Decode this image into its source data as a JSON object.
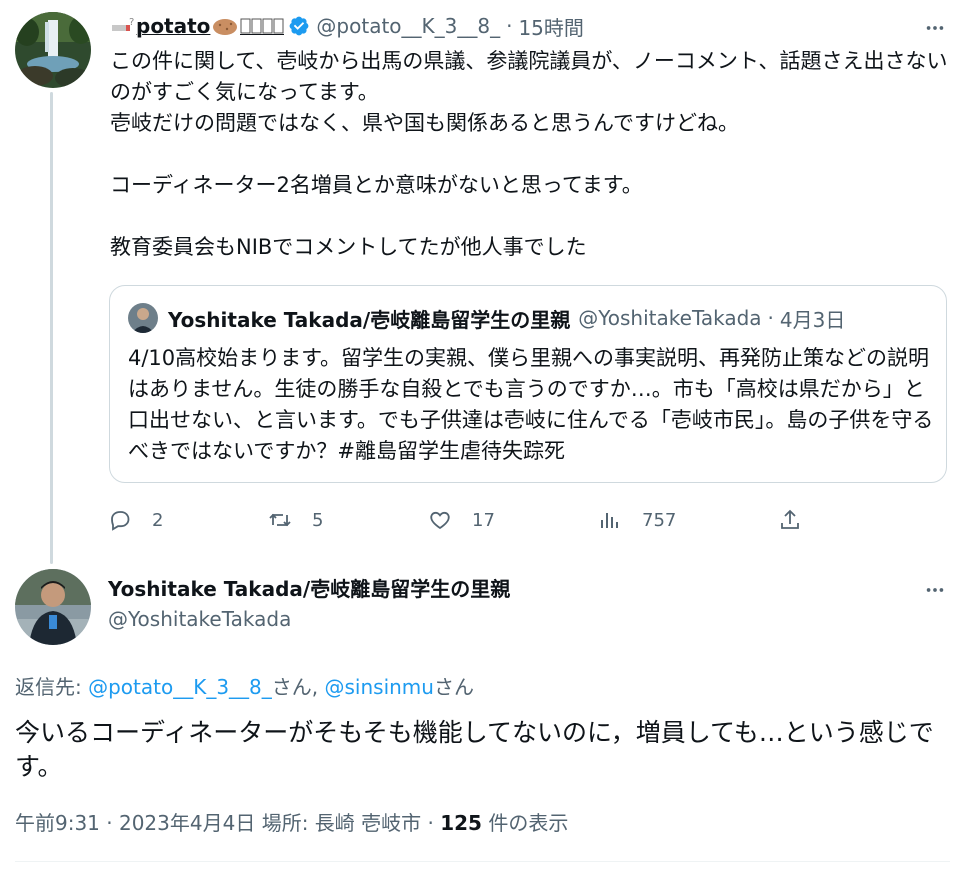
{
  "tweet1": {
    "display_name": "potato",
    "handle": "@potato__K_3__8_",
    "time": "15時間",
    "separator": "·",
    "body": "この件に関して、壱岐から出馬の県議、参議院議員が、ノーコメント、話題さえ出さないのがすごく気になってます。\n壱岐だけの問題ではなく、県や国も関係あると思うんですけどね。\n\nコーディネーター2名増員とか意味がないと思ってます。\n\n教育委員会もNIBでコメントしてたが他人事でした",
    "quote": {
      "name": "Yoshitake Takada/壱岐離島留学生の里親",
      "handle": "@YoshitakeTakada",
      "separator": "·",
      "date": "4月3日",
      "body": "4/10高校始まります。留学生の実親、僕ら里親への事実説明、再発防止策などの説明はありません。生徒の勝手な自殺とでも言うのですか…。市も「高校は県だから」と口出せない、と言います。でも子供達は壱岐に住んでる「壱岐市民」。島の子供を守るべきではないですか？#離島留学生虐待失踪死"
    },
    "actions": {
      "replies": "2",
      "retweets": "5",
      "likes": "17",
      "views": "757"
    }
  },
  "tweet2": {
    "name": "Yoshitake Takada/壱岐離島留学生の里親",
    "handle": "@YoshitakeTakada",
    "reply_prefix": "返信先: ",
    "reply_user1": "@potato__K_3__8_",
    "reply_suffix1": "さん, ",
    "reply_user2": "@sinsinmu",
    "reply_suffix2": "さん",
    "body": "今いるコーディネーターがそもそも機能してないのに，増員しても…という感じです。",
    "meta_time": "午前9:31 · 2023年4月4日 場所: 長崎 壱岐市 · ",
    "meta_views": "125",
    "meta_views_suffix": " 件の表示"
  },
  "colors": {
    "accent": "#1d9bf0",
    "muted": "#536471",
    "text": "#0f1419",
    "border": "#cfd9de"
  },
  "icons": [
    "waterfall-avatar",
    "verified-badge-icon",
    "more-icon",
    "reply-icon",
    "retweet-icon",
    "like-icon",
    "views-icon",
    "share-icon",
    "person-avatar"
  ]
}
